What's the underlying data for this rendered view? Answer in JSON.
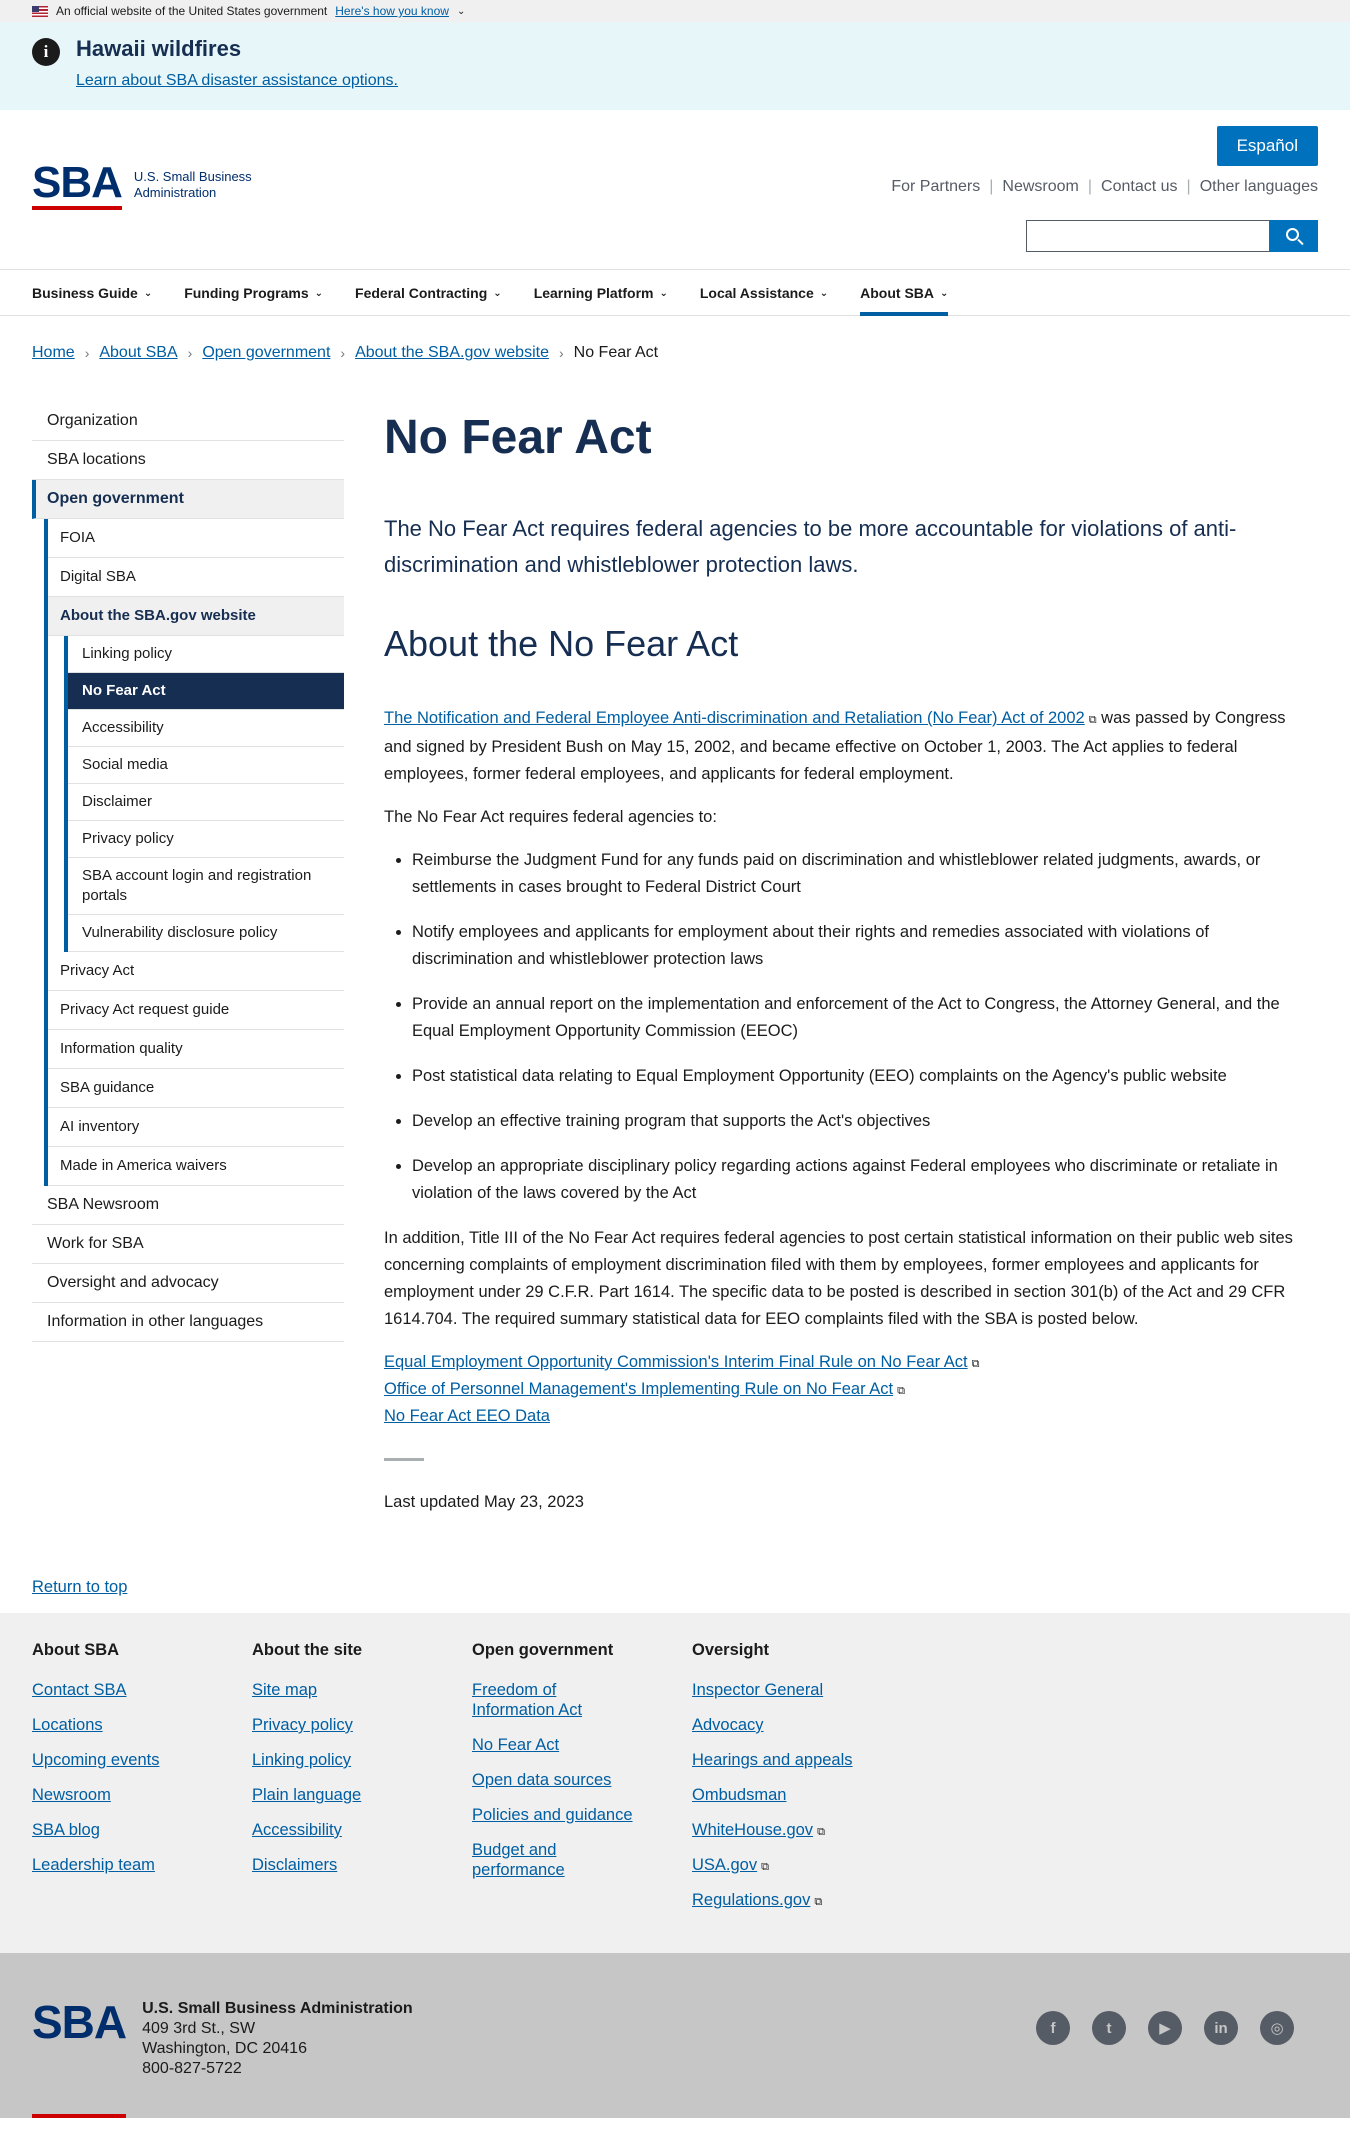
{
  "gov_banner": {
    "text": "An official website of the United States government",
    "link": "Here's how you know"
  },
  "alert": {
    "title": "Hawaii wildfires",
    "link": "Learn about SBA disaster assistance options."
  },
  "header": {
    "logo_mark": "SBA",
    "logo_line1": "U.S. Small Business",
    "logo_line2": "Administration",
    "espanol": "Español",
    "util_nav": [
      "For Partners",
      "Newsroom",
      "Contact us",
      "Other languages"
    ]
  },
  "nav": [
    "Business Guide",
    "Funding Programs",
    "Federal Contracting",
    "Learning Platform",
    "Local Assistance",
    "About SBA"
  ],
  "breadcrumb": [
    "Home",
    "About SBA",
    "Open government",
    "About the SBA.gov website",
    "No Fear Act"
  ],
  "sidenav": {
    "top": [
      "Organization",
      "SBA locations",
      "Open government"
    ],
    "open_gov": [
      "FOIA",
      "Digital SBA",
      "About the SBA.gov website"
    ],
    "website": [
      "Linking policy",
      "No Fear Act",
      "Accessibility",
      "Social media",
      "Disclaimer",
      "Privacy policy",
      "SBA account login and registration portals",
      "Vulnerability disclosure policy"
    ],
    "open_gov_rest": [
      "Privacy Act",
      "Privacy Act request guide",
      "Information quality",
      "SBA guidance",
      "AI inventory",
      "Made in America waivers"
    ],
    "bottom": [
      "SBA Newsroom",
      "Work for SBA",
      "Oversight and advocacy",
      "Information in other languages"
    ]
  },
  "main": {
    "title": "No Fear Act",
    "lead": "The No Fear Act requires federal agencies to be more accountable for violations of anti-discrimination and whistleblower protection laws.",
    "section_title": "About the No Fear Act",
    "intro_link": "The Notification and Federal Employee Anti-discrimination and Retaliation (No Fear) Act of 2002",
    "intro_rest": " was passed by Congress and signed by President Bush on May 15, 2002, and became effective on October 1, 2003. The Act applies to federal employees, former federal employees, and applicants for federal employment.",
    "requires": "The No Fear Act requires federal agencies to:",
    "bullets": [
      "Reimburse the Judgment Fund for any funds paid on discrimination and whistleblower related judgments, awards, or settlements in cases brought to Federal District Court",
      "Notify employees and applicants for employment about their rights and remedies associated with violations of discrimination and whistleblower protection laws",
      "Provide an annual report on the implementation and enforcement of the Act to Congress, the Attorney General, and the Equal Employment Opportunity Commission (EEOC)",
      "Post statistical data relating to Equal Employment Opportunity (EEO) complaints on the Agency's public website",
      "Develop an effective training program that supports the Act's objectives",
      "Develop an appropriate disciplinary policy regarding actions against Federal employees who discriminate or retaliate in violation of the laws covered by the Act"
    ],
    "addition": "In addition, Title III of the No Fear Act requires federal agencies to post certain statistical information on their public web sites concerning complaints of employment discrimination filed with them by employees, former employees and applicants for employment under 29 C.F.R. Part 1614. The specific data to be posted is described in section 301(b) of the Act and 29 CFR 1614.704. The required summary statistical data for EEO complaints filed with the SBA is posted below.",
    "links": [
      "Equal Employment Opportunity Commission's Interim Final Rule on No Fear Act",
      "Office of Personnel Management's Implementing Rule on No Fear Act",
      "No Fear Act EEO Data"
    ],
    "updated": "Last updated May 23, 2023"
  },
  "return_top": "Return to top",
  "footer": {
    "columns": [
      {
        "title": "About SBA",
        "links": [
          "Contact SBA",
          "Locations",
          "Upcoming events",
          "Newsroom",
          "SBA blog",
          "Leadership team"
        ]
      },
      {
        "title": "About the site",
        "links": [
          "Site map",
          "Privacy policy",
          "Linking policy",
          "Plain language",
          "Accessibility",
          "Disclaimers"
        ]
      },
      {
        "title": "Open government",
        "links": [
          "Freedom of Information Act",
          "No Fear Act",
          "Open data sources",
          "Policies and guidance",
          "Budget and performance"
        ]
      },
      {
        "title": "Oversight",
        "links": [
          "Inspector General",
          "Advocacy",
          "Hearings and appeals",
          "Ombudsman",
          "WhiteHouse.gov",
          "USA.gov",
          "Regulations.gov"
        ]
      }
    ],
    "org": "U.S. Small Business Administration",
    "address1": "409 3rd St., SW",
    "address2": "Washington, DC 20416",
    "phone": "800-827-5722",
    "social": [
      "facebook-icon",
      "twitter-icon",
      "youtube-icon",
      "linkedin-icon",
      "instagram-icon"
    ]
  }
}
